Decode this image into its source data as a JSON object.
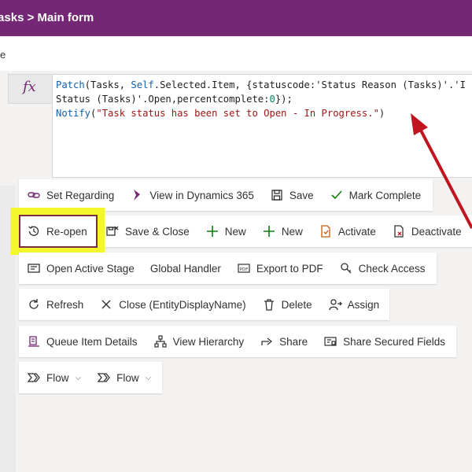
{
  "header": {
    "title": "Tasks > Main form"
  },
  "subbar": {
    "text": "e"
  },
  "formula": {
    "fx_label": "fx",
    "lines": [
      "Patch(Tasks, Self.Selected.Item, {statuscode:'Status Reason (Tasks)'.'I",
      "Status (Tasks)'.Open,percentcomplete:0});",
      "Notify(\"Task status has been set to Open - In Progress.\")"
    ]
  },
  "toolbar": {
    "row1": [
      {
        "label": "Set Regarding",
        "icon": "link-icon"
      },
      {
        "label": "View in Dynamics 365",
        "icon": "dynamics-icon"
      },
      {
        "label": "Save",
        "icon": "save-icon"
      },
      {
        "label": "Mark Complete",
        "icon": "checkmark-icon"
      }
    ],
    "row2": [
      {
        "label": "Re-open",
        "icon": "history-icon"
      },
      {
        "label": "Save & Close",
        "icon": "save-close-icon"
      },
      {
        "label": "New",
        "icon": "plus-icon"
      },
      {
        "label": "New",
        "icon": "plus-icon"
      },
      {
        "label": "Activate",
        "icon": "activate-icon"
      },
      {
        "label": "Deactivate",
        "icon": "deactivate-icon"
      }
    ],
    "row3": [
      {
        "label": "Open Active Stage",
        "icon": "stage-icon"
      },
      {
        "label": "Global Handler",
        "icon": ""
      },
      {
        "label": "Export to PDF",
        "icon": "pdf-icon"
      },
      {
        "label": "Check Access",
        "icon": "key-search-icon"
      }
    ],
    "row4": [
      {
        "label": "Refresh",
        "icon": "refresh-icon"
      },
      {
        "label": "Close (EntityDisplayName)",
        "icon": "close-icon"
      },
      {
        "label": "Delete",
        "icon": "trash-icon"
      },
      {
        "label": "Assign",
        "icon": "assign-icon"
      }
    ],
    "row5": [
      {
        "label": "Queue Item Details",
        "icon": "queue-icon"
      },
      {
        "label": "View Hierarchy",
        "icon": "hierarchy-icon"
      },
      {
        "label": "Share",
        "icon": "share-icon"
      },
      {
        "label": "Share Secured Fields",
        "icon": "secured-share-icon"
      }
    ],
    "row6": [
      {
        "label": "Flow",
        "icon": "flow-icon"
      },
      {
        "label": "Flow",
        "icon": "flow-icon"
      }
    ]
  },
  "colors": {
    "brand": "#742774",
    "highlight": "#f4f72a",
    "arrow": "#c0141f",
    "border": "#7a2d42"
  }
}
